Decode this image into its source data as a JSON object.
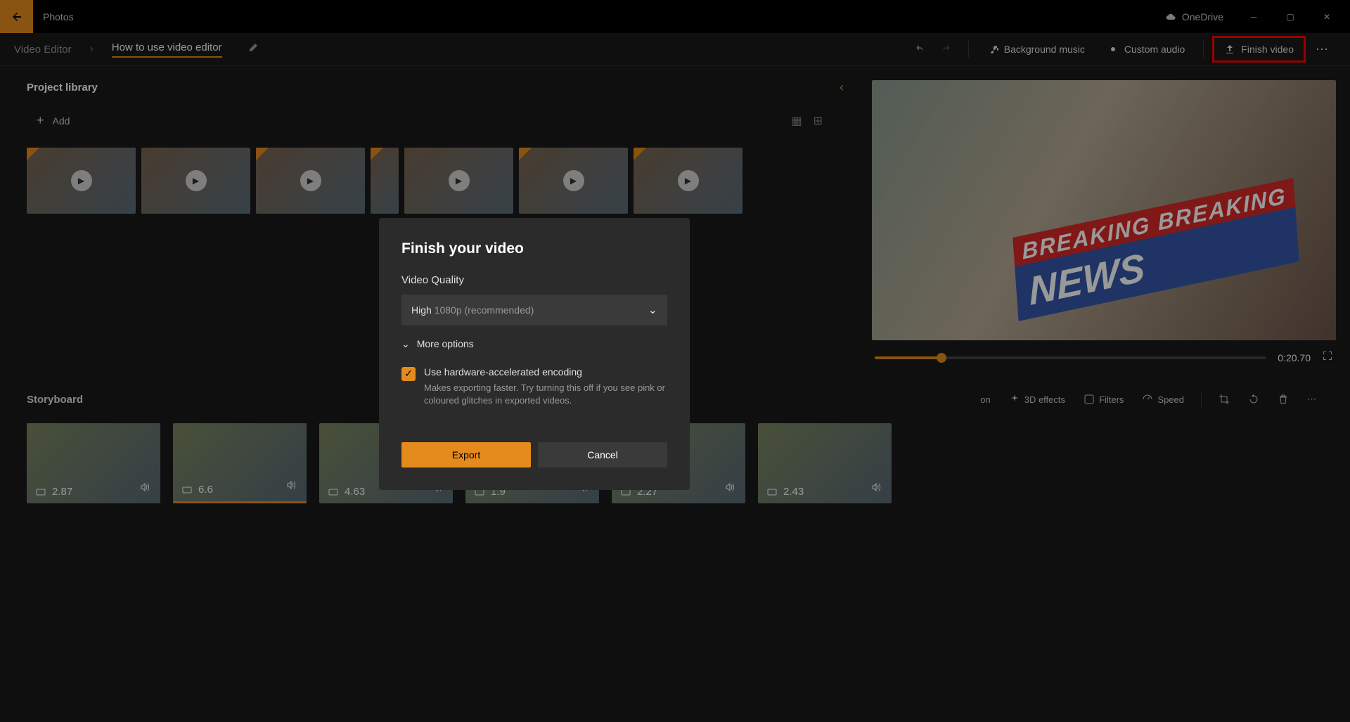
{
  "titlebar": {
    "app_name": "Photos",
    "onedrive": "OneDrive"
  },
  "toolbar": {
    "section": "Video Editor",
    "project": "How to use video editor",
    "bg_music": "Background music",
    "custom_audio": "Custom audio",
    "finish_video": "Finish video"
  },
  "library": {
    "title": "Project library",
    "add": "Add"
  },
  "preview": {
    "news_top": "BREAKING BREAKING",
    "news_main": "NEWS",
    "time": "0:20.70"
  },
  "storyboard": {
    "title": "Storyboard",
    "tools": {
      "effects_partial": "on",
      "effects3d": "3D effects",
      "filters": "Filters",
      "speed": "Speed"
    },
    "clips": [
      {
        "dur": "2.87"
      },
      {
        "dur": "6.6"
      },
      {
        "dur": "4.63"
      },
      {
        "dur": "1.9"
      },
      {
        "dur": "2.27"
      },
      {
        "dur": "2.43"
      }
    ]
  },
  "modal": {
    "title": "Finish your video",
    "quality_label": "Video Quality",
    "quality_sel_main": "High",
    "quality_sel_extra": "1080p (recommended)",
    "more_options": "More options",
    "hwaccel": "Use hardware-accelerated encoding",
    "hwaccel_desc": "Makes exporting faster. Try turning this off if you see pink or coloured glitches in exported videos.",
    "export": "Export",
    "cancel": "Cancel"
  }
}
